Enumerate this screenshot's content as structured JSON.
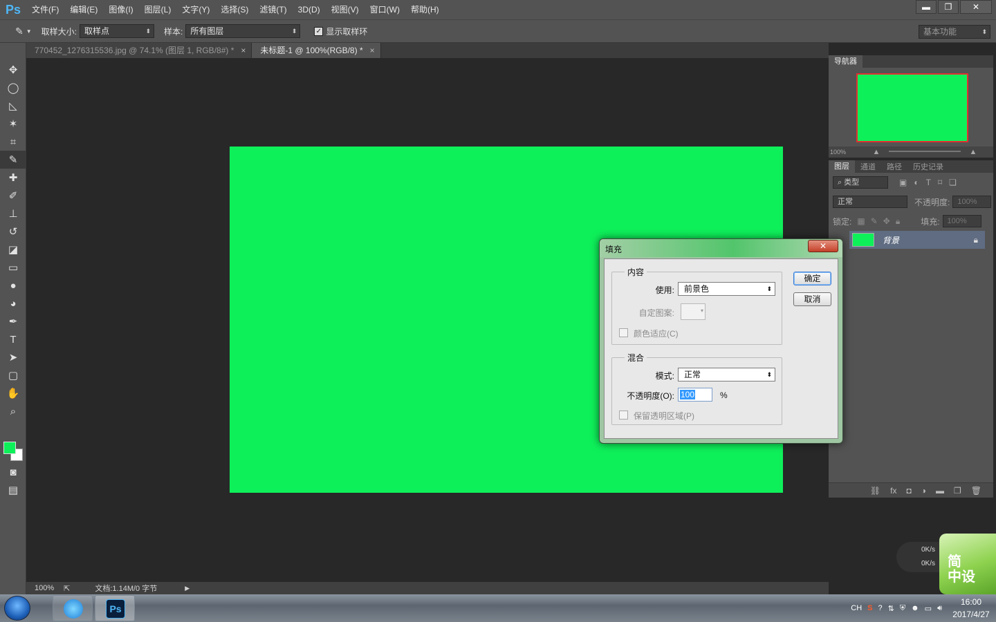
{
  "app": {
    "logo": "Ps"
  },
  "menubar": {
    "items": [
      "文件(F)",
      "编辑(E)",
      "图像(I)",
      "图层(L)",
      "文字(Y)",
      "选择(S)",
      "滤镜(T)",
      "3D(D)",
      "视图(V)",
      "窗口(W)",
      "帮助(H)"
    ],
    "controls": {
      "minimize": "▬",
      "restore": "❐",
      "close": "✕"
    }
  },
  "options": {
    "sample_size_label": "取样大小:",
    "sample_size_value": "取样点",
    "sample_label": "样本:",
    "sample_value": "所有图层",
    "show_ring_label": "显示取样环",
    "show_ring_checked": true,
    "workspace": "基本功能"
  },
  "tabs": [
    {
      "label": "770452_1276315536.jpg @ 74.1% (图层 1, RGB/8#) *",
      "active": false
    },
    {
      "label": "未标题-1 @ 100%(RGB/8) *",
      "active": true
    }
  ],
  "tools": [
    "move-tool",
    "ellipse-marquee-tool",
    "polygonal-lasso-tool",
    "magic-wand-tool",
    "crop-tool",
    "eyedropper-tool",
    "healing-brush-tool",
    "brush-tool",
    "clone-stamp-tool",
    "history-brush-tool",
    "eraser-tool",
    "gradient-tool",
    "blur-tool",
    "dodge-tool",
    "pen-tool",
    "type-tool",
    "path-selection-tool",
    "shape-tool",
    "hand-tool",
    "zoom-tool"
  ],
  "colors": {
    "foreground": "#0ef05a",
    "background": "#ffffff",
    "canvas": "#0ef05a"
  },
  "status": {
    "zoom": "100%",
    "doc_info": "文档:1.14M/0 字节"
  },
  "navigator": {
    "title": "导航器",
    "zoom": "100%"
  },
  "layers_panel": {
    "tabs": [
      "图层",
      "通道",
      "路径",
      "历史记录"
    ],
    "filter_label": "类型",
    "blend_mode": "正常",
    "opacity_label": "不透明度:",
    "opacity_value": "100%",
    "lock_label": "锁定:",
    "fill_label": "填充:",
    "fill_value": "100%",
    "layers": [
      {
        "name": "背景",
        "locked": true
      }
    ]
  },
  "dialog": {
    "title": "填充",
    "close_label": "✕",
    "content_group": "内容",
    "use_label": "使用:",
    "use_value": "前景色",
    "custom_pattern_label": "自定图案:",
    "color_adapt_label": "颜色适应(C)",
    "blend_group": "混合",
    "mode_label": "模式:",
    "mode_value": "正常",
    "opacity_label": "不透明度(O):",
    "opacity_value": "100",
    "opacity_unit": "%",
    "preserve_label": "保留透明区域(P)",
    "ok_label": "确定",
    "cancel_label": "取消"
  },
  "speed_widget": {
    "up": "0K/s",
    "down": "0K/s"
  },
  "brand_badge": {
    "line1": "简",
    "line2": "中设"
  },
  "taskbar": {
    "tray": {
      "lang": "CH",
      "time": "16:00",
      "date": "2017/4/27"
    }
  }
}
